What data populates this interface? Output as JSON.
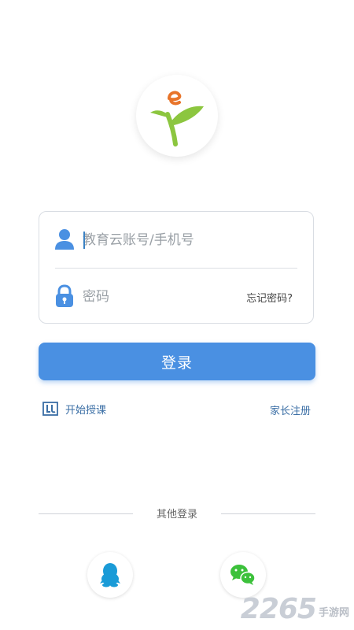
{
  "login": {
    "account_placeholder": "教育云账号/手机号",
    "password_placeholder": "密码",
    "forgot_password": "忘记密码?",
    "submit_label": "登录"
  },
  "links": {
    "start_class": "开始授课",
    "parent_register": "家长注册"
  },
  "other_login": {
    "label": "其他登录",
    "providers": [
      "qq-icon",
      "wechat-icon"
    ]
  },
  "watermark": {
    "number": "2265",
    "text": "手游网"
  },
  "colors": {
    "primary": "#4a90e2",
    "link": "#3a6ea5",
    "logo_green": "#8cc63f",
    "logo_orange": "#e8742a",
    "qq": "#1a9bd7",
    "wechat": "#3cc13b"
  }
}
